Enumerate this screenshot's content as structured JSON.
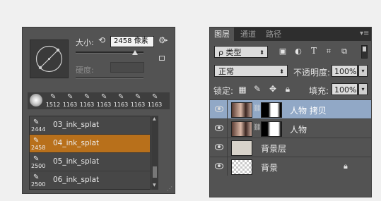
{
  "brush_panel": {
    "size_label": "大小:",
    "size_value": "2458 像素",
    "hardness_label": "硬度:",
    "size_slider_level": 0.88,
    "tips": [
      "1512",
      "1163",
      "1163",
      "1163",
      "1163",
      "1163",
      "1163"
    ],
    "presets": [
      {
        "size": "2444",
        "name": "03_ink_splat",
        "selected": false
      },
      {
        "size": "2458",
        "name": "04_ink_splat",
        "selected": true
      },
      {
        "size": "2500",
        "name": "05_ink_splat",
        "selected": false
      },
      {
        "size": "2500",
        "name": "06_ink_splat",
        "selected": false
      }
    ]
  },
  "layers_panel": {
    "tabs": [
      "图层",
      "通道",
      "路径"
    ],
    "active_tab": "图层",
    "filter_label": "ρ 类型",
    "blend_mode": "正常",
    "opacity_label": "不透明度:",
    "opacity_value": "100%",
    "lock_label": "锁定:",
    "fill_label": "填充:",
    "fill_value": "100%",
    "layers": [
      {
        "name": "人物 拷贝",
        "selected": true,
        "has_mask": true
      },
      {
        "name": "人物",
        "selected": false,
        "has_mask": true
      },
      {
        "name": "背景层",
        "selected": false,
        "has_mask": false
      },
      {
        "name": "背景",
        "selected": false,
        "has_mask": false,
        "locked": true
      }
    ]
  },
  "colors": {
    "panel_bg": "#535353",
    "selected_preset": "#b8701b",
    "selected_layer": "#91a8c6"
  }
}
